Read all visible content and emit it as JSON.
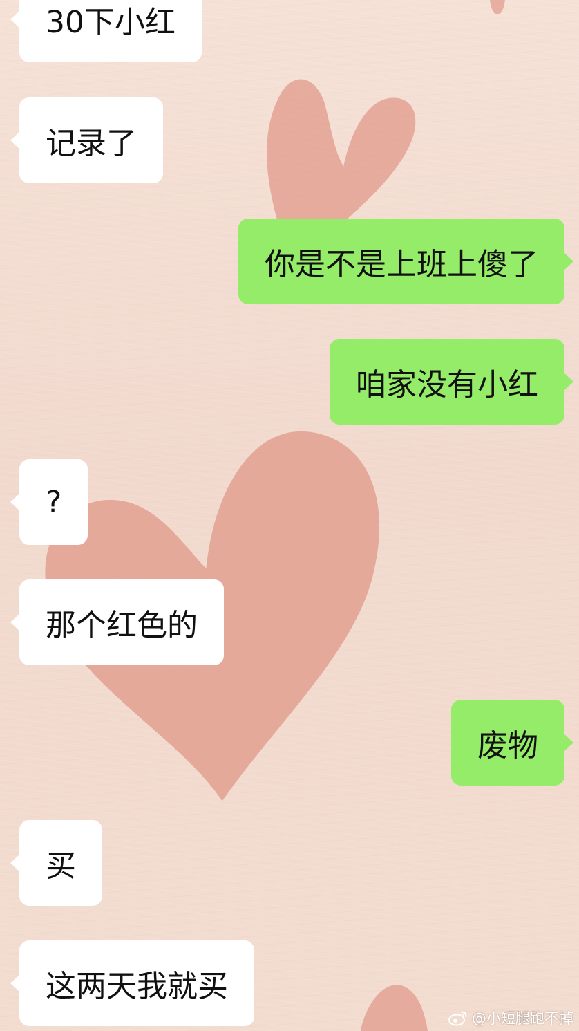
{
  "chat": {
    "messages": [
      {
        "side": "in",
        "text": "30下小红"
      },
      {
        "side": "in",
        "text": "记录了"
      },
      {
        "side": "out",
        "text": "你是不是上班上傻了"
      },
      {
        "side": "out",
        "text": "咱家没有小红"
      },
      {
        "side": "in",
        "text": "?"
      },
      {
        "side": "in",
        "text": "那个红色的"
      },
      {
        "side": "out",
        "text": "废物"
      },
      {
        "side": "in",
        "text": "买"
      },
      {
        "side": "in",
        "text": "这两天我就买"
      }
    ]
  },
  "watermark": {
    "text": "@小短腿跑不掉",
    "icon": "weibo-icon"
  },
  "colors": {
    "background": "#f3ddd2",
    "heart": "#e3a293",
    "incoming_bubble": "#ffffff",
    "outgoing_bubble": "#95ec69"
  }
}
